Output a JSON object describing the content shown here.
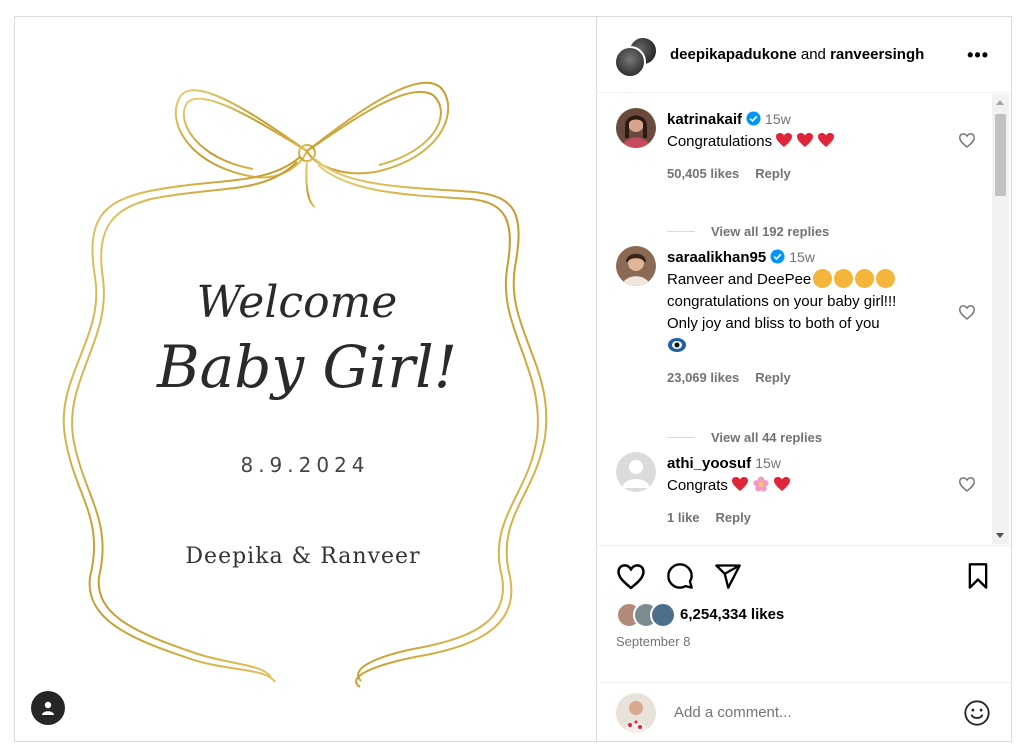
{
  "post": {
    "image": {
      "script_line1": "Welcome",
      "script_line2": "Baby Girl!",
      "date": "8.9.2024",
      "names": "Deepika & Ranveer",
      "ribbon_color": "#c8a33a"
    },
    "header": {
      "user1": "deepikapadukone",
      "and": "and",
      "user2": "ranveersingh",
      "more_icon": "more-horizontal-icon"
    }
  },
  "comments": [
    {
      "user": "katrinakaif",
      "verified": true,
      "time": "15w",
      "text": "Congratulations",
      "emojis": [
        "red-heart",
        "red-heart",
        "red-heart"
      ],
      "likes": "50,405 likes",
      "reply": "Reply",
      "view_replies": "View all 192 replies"
    },
    {
      "user": "saraalikhan95",
      "verified": true,
      "time": "15w",
      "text_l1": "Ranveer and DeePee",
      "text_l2": "congratulations on your baby girl!!!",
      "text_l3": "Only joy and bliss to both of you",
      "likes": "23,069 likes",
      "reply": "Reply",
      "view_replies": "View all 44 replies"
    },
    {
      "user": "athi_yoosuf",
      "verified": false,
      "time": "15w",
      "text": "Congrats",
      "likes": "1 like",
      "reply": "Reply"
    }
  ],
  "actions": {
    "likes": "6,254,334 likes",
    "date": "September 8",
    "add_comment_placeholder": "Add a comment..."
  },
  "colors": {
    "verified": "#0095f6",
    "heart_emoji": "#e0243a",
    "muted": "#737373"
  }
}
